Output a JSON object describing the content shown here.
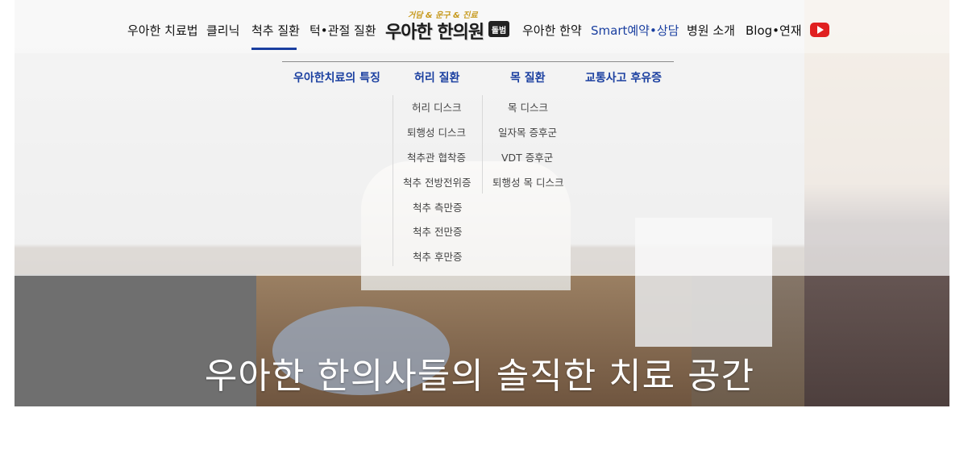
{
  "nav": {
    "left_items": [
      "우아한 치료법",
      "클리닉",
      "척추 질환",
      "턱•관절 질환"
    ],
    "right_items": [
      "우아한 한약",
      "Smart예약•상담",
      "병원 소개",
      "Blog•연재"
    ],
    "active_item": "척추 질환",
    "accent_color": "#1a3fa0",
    "youtube_icon": "youtube-icon"
  },
  "logo": {
    "tagline": "거담 & 운구 & 진료",
    "name": "우아한 한의원",
    "badge": "돌범"
  },
  "dropdown": {
    "headers": [
      "우아한치료의 특징",
      "허리 질환",
      "목 질환",
      "교통사고 후유증"
    ],
    "waist_items": [
      "허리 디스크",
      "퇴행성 디스크",
      "척추관 협착증",
      "척추 전방전위증",
      "척추 측만증",
      "척추 전만증",
      "척추 후만증"
    ],
    "neck_items": [
      "목 디스크",
      "일자목 증후군",
      "VDT 증후군",
      "퇴행성 목 디스크"
    ]
  },
  "hero": {
    "caption": "우아한 한의사들의 솔직한 치료 공간"
  }
}
